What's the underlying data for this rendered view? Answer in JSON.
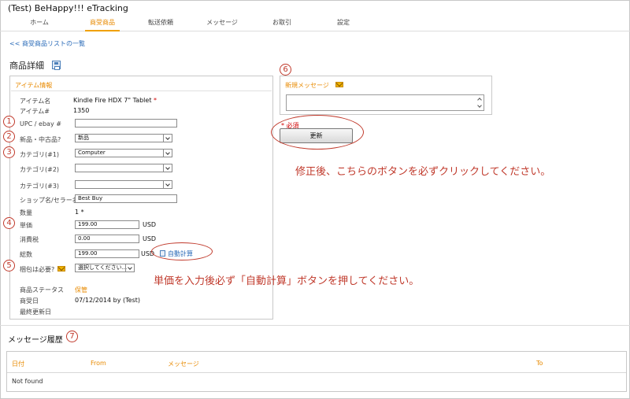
{
  "app": {
    "title": "(Test) BeHappy!!! eTracking"
  },
  "nav": {
    "tabs": [
      {
        "label": "ホーム"
      },
      {
        "label": "商受商品"
      },
      {
        "label": "転送依頼"
      },
      {
        "label": "メッセージ"
      },
      {
        "label": "お取引"
      },
      {
        "label": "設定"
      }
    ]
  },
  "back_link": "<< 商受商品リストの一覧",
  "page_title": "商品詳細",
  "item_panel": {
    "header": "アイテム情報",
    "item_name_label": "アイテム名",
    "item_name_value": "Kindle Fire HDX 7\" Tablet",
    "required_mark": "*",
    "item_no_label": "アイテム#",
    "item_no_value": "1350",
    "upc_label": "UPC / ebay #",
    "upc_value": "",
    "condition_label": "新品・中古品?",
    "condition_value": "新品",
    "category1_label": "カテゴリ(#1)",
    "category1_value": "Computer",
    "category2_label": "カテゴリ(#2)",
    "category2_value": "",
    "category3_label": "カテゴリ(#3)",
    "category3_value": "",
    "shop_label": "ショップ名/セラー名",
    "shop_value": "Best Buy",
    "qty_label": "数量",
    "qty_value": "1 *",
    "unit_price_label": "単価",
    "unit_price_value": "199.00",
    "tax_label": "消費税",
    "tax_value": "0.00",
    "total_label": "総数",
    "total_value": "199.00",
    "currency": "USD",
    "auto_calc": "自動計算",
    "packing_label": "梱包は必要?",
    "packing_value": "選択してください...",
    "status_label": "商品ステータス",
    "status_value": "保管",
    "received_label": "商受日",
    "received_value": "07/12/2014 by (Test)",
    "updated_label": "最終更新日",
    "updated_value": ""
  },
  "message_panel": {
    "header": "新規メッセージ",
    "value": ""
  },
  "required_note": "* 必須",
  "update_button": "更新",
  "annotations": {
    "note1": "修正後、こちらのボタンを必ずクリックしてください。",
    "note2": "単価を入力後必ず「自動計算」ボタンを押してください。",
    "n1": "1",
    "n2": "2",
    "n3": "3",
    "n4": "4",
    "n5": "5",
    "n6": "6",
    "n7": "7"
  },
  "history": {
    "title": "メッセージ履歴",
    "columns": [
      "日付",
      "From",
      "メッセージ",
      "To"
    ],
    "empty_text": "Not found"
  },
  "colors": {
    "accent": "#e88a00",
    "annotation": "#c0392b",
    "link": "#2a6bb8"
  }
}
